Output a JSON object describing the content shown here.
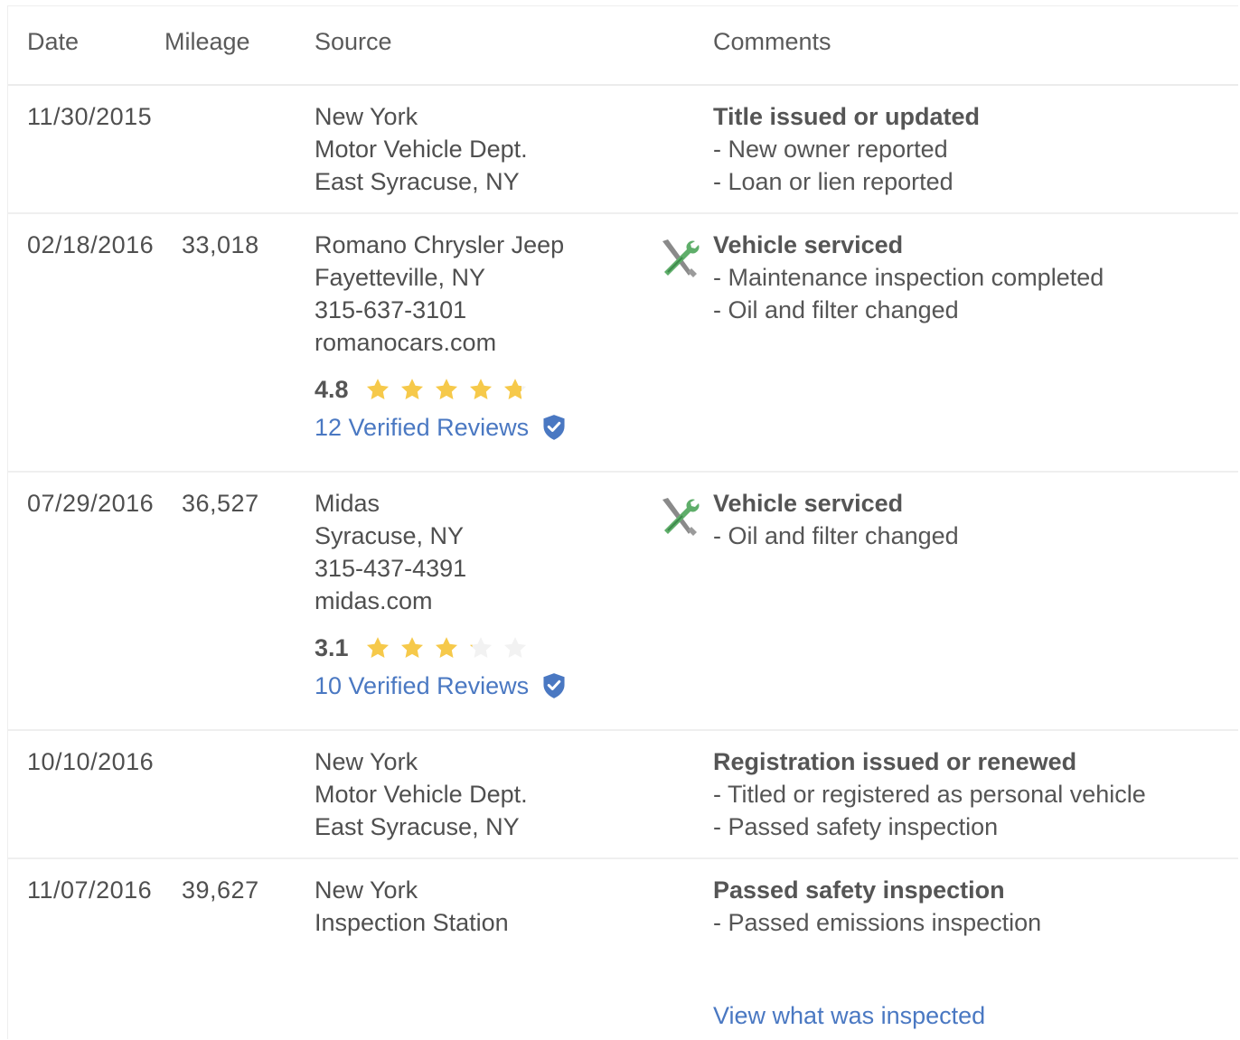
{
  "headers": {
    "date": "Date",
    "mileage": "Mileage",
    "source": "Source",
    "comments": "Comments"
  },
  "colors": {
    "text": "#4f4f4f",
    "link": "#4a78c2",
    "star_filled": "#f6c94a",
    "star_empty": "#f2f2f2",
    "shield": "#4a78c2"
  },
  "records": [
    {
      "date": "11/30/2015",
      "mileage": "",
      "source": [
        "New York",
        "Motor Vehicle Dept.",
        "East Syracuse, NY"
      ],
      "icon": "",
      "comment_title": "Title issued or updated",
      "comment_details": [
        "- New owner reported",
        "- Loan or lien reported"
      ]
    },
    {
      "date": "02/18/2016",
      "mileage": "33,018",
      "source": [
        "Romano Chrysler Jeep",
        "Fayetteville, NY",
        "315-637-3101",
        "romanocars.com"
      ],
      "rating": "4.8",
      "rating_value": 4.8,
      "reviews": "12 Verified Reviews",
      "icon": "tools-icon",
      "comment_title": "Vehicle serviced",
      "comment_details": [
        "- Maintenance inspection completed",
        "- Oil and filter changed"
      ]
    },
    {
      "date": "07/29/2016",
      "mileage": "36,527",
      "source": [
        "Midas",
        "Syracuse, NY",
        "315-437-4391",
        "midas.com"
      ],
      "rating": "3.1",
      "rating_value": 3.1,
      "reviews": "10 Verified Reviews",
      "icon": "tools-icon",
      "comment_title": "Vehicle serviced",
      "comment_details": [
        "- Oil and filter changed"
      ]
    },
    {
      "date": "10/10/2016",
      "mileage": "",
      "source": [
        "New York",
        "Motor Vehicle Dept.",
        "East Syracuse, NY"
      ],
      "icon": "",
      "comment_title": "Registration issued or renewed",
      "comment_details": [
        "- Titled or registered as personal vehicle",
        "- Passed safety inspection"
      ]
    },
    {
      "date": "11/07/2016",
      "mileage": "39,627",
      "source": [
        "New York",
        "Inspection Station"
      ],
      "icon": "",
      "comment_title": "Passed safety inspection",
      "comment_details": [
        "- Passed emissions inspection"
      ],
      "link": "View what was inspected"
    }
  ]
}
